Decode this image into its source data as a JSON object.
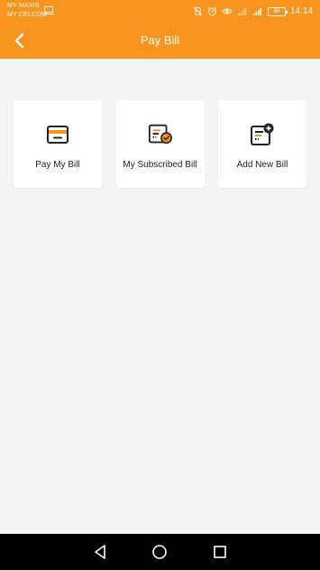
{
  "status_bar": {
    "carrier_1": "MY MAXIS",
    "carrier_2": "MY CELCOM",
    "battery": "88",
    "time": "14:14",
    "icons": [
      "screen-cast-icon",
      "vibrate-off-icon",
      "alarm-icon",
      "eye-icon",
      "signal-icon",
      "signal-icon",
      "battery-icon"
    ]
  },
  "app_bar": {
    "title": "Pay Bill",
    "back_icon": "chevron-left-icon",
    "background": "#f7941d"
  },
  "tiles": [
    {
      "label": "Pay My Bill",
      "icon": "card-icon"
    },
    {
      "label": "My Subscribed Bill",
      "icon": "subscribed-bill-icon"
    },
    {
      "label": "Add New Bill",
      "icon": "add-bill-icon"
    }
  ],
  "nav_bar": {
    "icons": [
      "back-triangle-icon",
      "home-circle-icon",
      "recents-square-icon"
    ]
  },
  "colors": {
    "accent": "#f7941d",
    "icon_dark": "#222222",
    "background": "#f4f4f4"
  }
}
